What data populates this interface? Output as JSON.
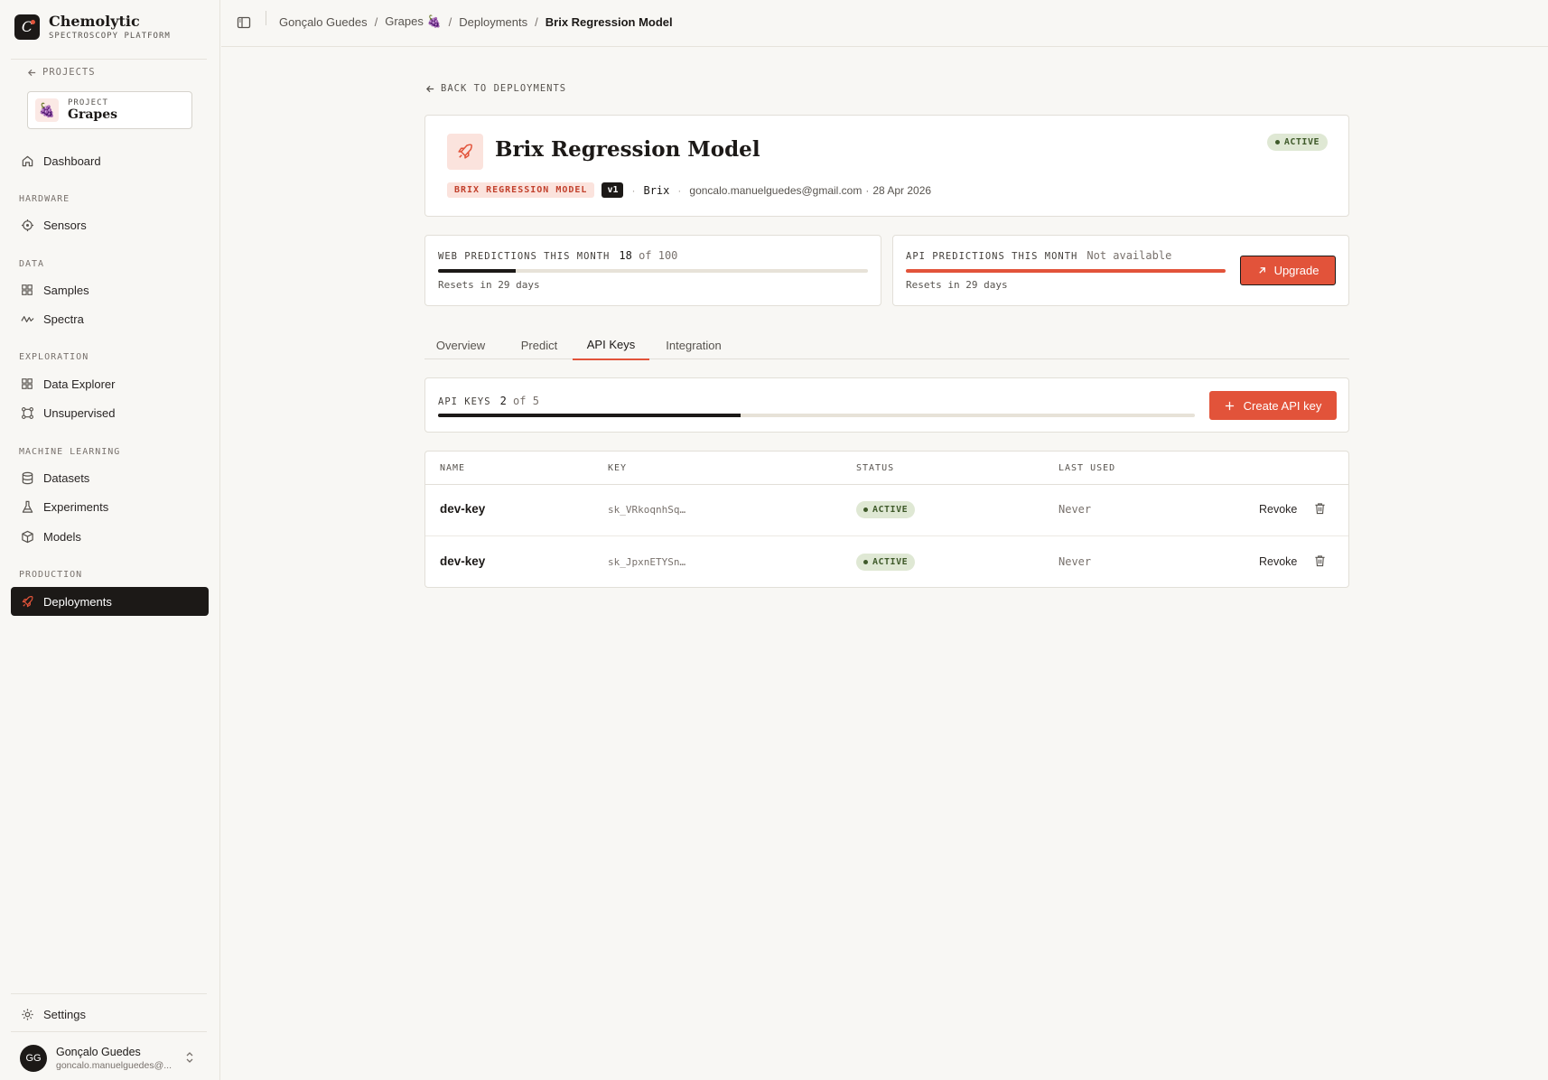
{
  "brand": {
    "name": "Chemolytic",
    "subtitle": "SPECTROSCOPY PLATFORM"
  },
  "sidebar": {
    "projects_link": "PROJECTS",
    "project": {
      "label": "PROJECT",
      "name": "Grapes",
      "emoji": "🍇"
    },
    "dashboard": "Dashboard",
    "sections": {
      "hardware": "HARDWARE",
      "data": "DATA",
      "exploration": "EXPLORATION",
      "machine_learning": "MACHINE LEARNING",
      "production": "PRODUCTION"
    },
    "items": {
      "sensors": "Sensors",
      "samples": "Samples",
      "spectra": "Spectra",
      "data_explorer": "Data Explorer",
      "unsupervised": "Unsupervised",
      "datasets": "Datasets",
      "experiments": "Experiments",
      "models": "Models",
      "deployments": "Deployments"
    },
    "settings": "Settings",
    "user": {
      "initials": "GG",
      "name": "Gonçalo Guedes",
      "email": "goncalo.manuelguedes@..."
    }
  },
  "breadcrumb": {
    "user": "Gonçalo Guedes",
    "project": "Grapes 🍇",
    "section": "Deployments",
    "current": "Brix Regression Model",
    "separator": "/"
  },
  "main": {
    "back_link": "BACK TO DEPLOYMENTS",
    "model": {
      "title": "Brix Regression Model",
      "status": "ACTIVE",
      "tag": "BRIX REGRESSION MODEL",
      "version": "v1",
      "target": "Brix",
      "author": "goncalo.manuelguedes@gmail.com",
      "date": "28 Apr 2026",
      "meta_separator": "·"
    },
    "web_usage": {
      "label": "WEB PREDICTIONS THIS MONTH",
      "used": "18",
      "of_text": "of 100",
      "fraction": 0.18,
      "reset": "Resets in 29 days"
    },
    "api_usage": {
      "label": "API PREDICTIONS THIS MONTH",
      "value": "Not available",
      "fraction": 1.0,
      "reset": "Resets in 29 days",
      "upgrade_label": "Upgrade"
    },
    "tabs": [
      "Overview",
      "Predict",
      "API Keys",
      "Integration"
    ],
    "active_tab": "API Keys",
    "api_keys": {
      "label": "API KEYS",
      "used": "2",
      "of_text": "of 5",
      "fraction": 0.4,
      "create_label": "Create API key"
    },
    "table": {
      "headers": {
        "name": "NAME",
        "key": "KEY",
        "status": "STATUS",
        "last_used": "LAST USED"
      },
      "rows": [
        {
          "name": "dev-key",
          "key": "sk_VRkoqnhSq…",
          "status": "ACTIVE",
          "last_used": "Never",
          "action": "Revoke"
        },
        {
          "name": "dev-key",
          "key": "sk_JpxnETYSn…",
          "status": "ACTIVE",
          "last_used": "Never",
          "action": "Revoke"
        }
      ]
    }
  },
  "colors": {
    "accent": "#e2533a",
    "dark": "#1c1917",
    "active_green_bg": "#dfe8d4",
    "active_green_fg": "#3f5a2a",
    "background": "#f8f7f4"
  }
}
